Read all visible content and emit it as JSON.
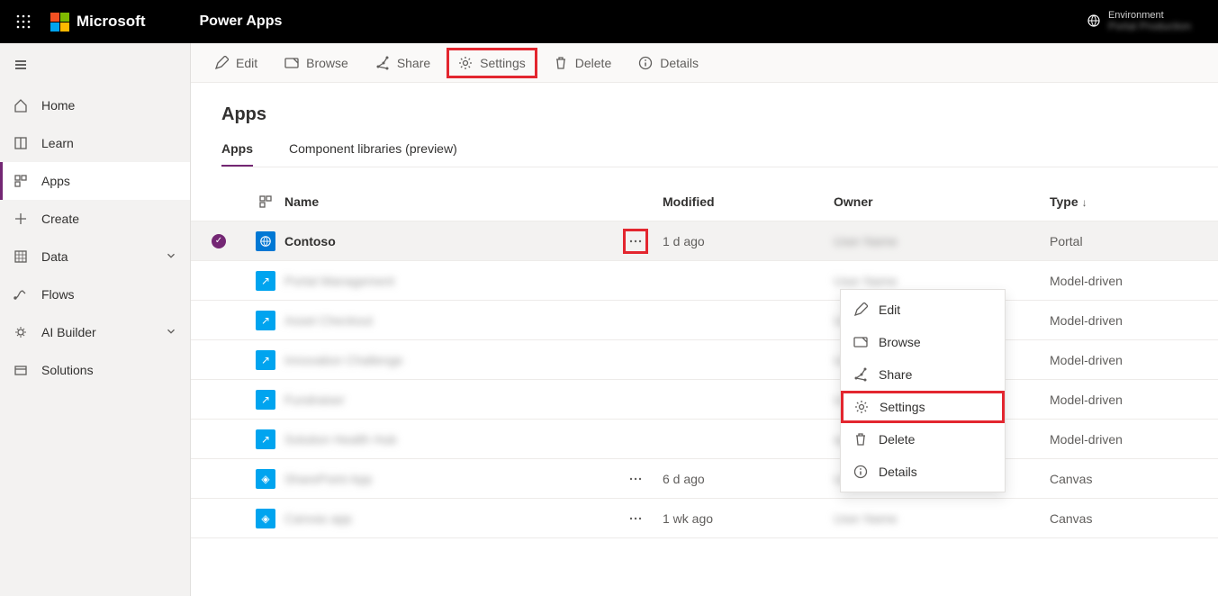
{
  "topbar": {
    "brand": "Microsoft",
    "product": "Power Apps",
    "env_label": "Environment",
    "env_name": "Portal Production"
  },
  "sidebar": {
    "items": [
      {
        "label": "Home"
      },
      {
        "label": "Learn"
      },
      {
        "label": "Apps"
      },
      {
        "label": "Create"
      },
      {
        "label": "Data"
      },
      {
        "label": "Flows"
      },
      {
        "label": "AI Builder"
      },
      {
        "label": "Solutions"
      }
    ]
  },
  "commands": {
    "edit": "Edit",
    "browse": "Browse",
    "share": "Share",
    "settings": "Settings",
    "delete": "Delete",
    "details": "Details"
  },
  "page": {
    "title": "Apps"
  },
  "tabs": {
    "apps": "Apps",
    "libraries": "Component libraries (preview)"
  },
  "columns": {
    "name": "Name",
    "modified": "Modified",
    "owner": "Owner",
    "type": "Type"
  },
  "rows": [
    {
      "name": "Contoso",
      "name_blur": false,
      "modified": "1 d ago",
      "owner": "User Name",
      "type": "Portal",
      "icon": "portal",
      "selected": true,
      "highlight_more": true
    },
    {
      "name": "Portal Management",
      "name_blur": true,
      "modified": "",
      "owner": "User Name",
      "type": "Model-driven",
      "icon": "md"
    },
    {
      "name": "Asset Checkout",
      "name_blur": true,
      "modified": "",
      "owner": "User Name",
      "type": "Model-driven",
      "icon": "md"
    },
    {
      "name": "Innovation Challenge",
      "name_blur": true,
      "modified": "",
      "owner": "User Name",
      "type": "Model-driven",
      "icon": "md"
    },
    {
      "name": "Fundraiser",
      "name_blur": true,
      "modified": "",
      "owner": "User Name",
      "type": "Model-driven",
      "icon": "md"
    },
    {
      "name": "Solution Health Hub",
      "name_blur": true,
      "modified": "",
      "owner": "system",
      "type": "Model-driven",
      "icon": "md"
    },
    {
      "name": "SharePoint App",
      "name_blur": true,
      "modified": "6 d ago",
      "owner": "User Name",
      "type": "Canvas",
      "icon": "canvas",
      "show_more": true
    },
    {
      "name": "Canvas app",
      "name_blur": true,
      "modified": "1 wk ago",
      "owner": "User Name",
      "type": "Canvas",
      "icon": "canvas",
      "show_more": true
    }
  ],
  "context_menu": {
    "edit": "Edit",
    "browse": "Browse",
    "share": "Share",
    "settings": "Settings",
    "delete": "Delete",
    "details": "Details"
  }
}
